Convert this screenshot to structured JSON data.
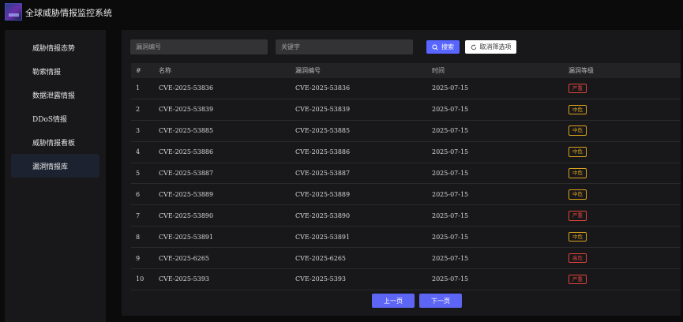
{
  "app": {
    "title": "全球威胁情报监控系统"
  },
  "sidebar": {
    "items": [
      {
        "label": "威胁情报态势"
      },
      {
        "label": "勒索情报"
      },
      {
        "label": "数据泄露情报"
      },
      {
        "label": "DDoS情报"
      },
      {
        "label": "威胁情报看板"
      },
      {
        "label": "漏洞情报库"
      }
    ],
    "active_index": 5
  },
  "filters": {
    "vuln_id_placeholder": "漏洞编号",
    "keyword_placeholder": "关键字",
    "search_label": "搜索",
    "clear_label": "取消筛选项"
  },
  "table": {
    "headers": [
      "#",
      "名称",
      "漏洞编号",
      "时间",
      "漏洞等级"
    ],
    "rows": [
      {
        "no": "1",
        "name": "CVE-2025-53836",
        "id": "CVE-2025-53836",
        "date": "2025-07-15",
        "level": "严重"
      },
      {
        "no": "2",
        "name": "CVE-2025-53839",
        "id": "CVE-2025-53839",
        "date": "2025-07-15",
        "level": "中危"
      },
      {
        "no": "3",
        "name": "CVE-2025-53885",
        "id": "CVE-2025-53885",
        "date": "2025-07-15",
        "level": "中危"
      },
      {
        "no": "4",
        "name": "CVE-2025-53886",
        "id": "CVE-2025-53886",
        "date": "2025-07-15",
        "level": "中危"
      },
      {
        "no": "5",
        "name": "CVE-2025-53887",
        "id": "CVE-2025-53887",
        "date": "2025-07-15",
        "level": "中危"
      },
      {
        "no": "6",
        "name": "CVE-2025-53889",
        "id": "CVE-2025-53889",
        "date": "2025-07-15",
        "level": "中危"
      },
      {
        "no": "7",
        "name": "CVE-2025-53890",
        "id": "CVE-2025-53890",
        "date": "2025-07-15",
        "level": "严重"
      },
      {
        "no": "8",
        "name": "CVE-2025-53891",
        "id": "CVE-2025-53891",
        "date": "2025-07-15",
        "level": "中危"
      },
      {
        "no": "9",
        "name": "CVE-2025-6265",
        "id": "CVE-2025-6265",
        "date": "2025-07-15",
        "level": "高危"
      },
      {
        "no": "10",
        "name": "CVE-2025-5393",
        "id": "CVE-2025-5393",
        "date": "2025-07-15",
        "level": "严重"
      }
    ]
  },
  "level_colors": {
    "严重": "#e0443a",
    "中危": "#d9a21b",
    "高危": "#e0443a"
  },
  "icons": {
    "search": "search-icon",
    "clear": "refresh-icon"
  },
  "pagination": {
    "prev_label": "上一页",
    "next_label": "下一页"
  },
  "colors": {
    "accent": "#5865ff",
    "background": "#0b0b0c",
    "panel": "#18181b"
  }
}
